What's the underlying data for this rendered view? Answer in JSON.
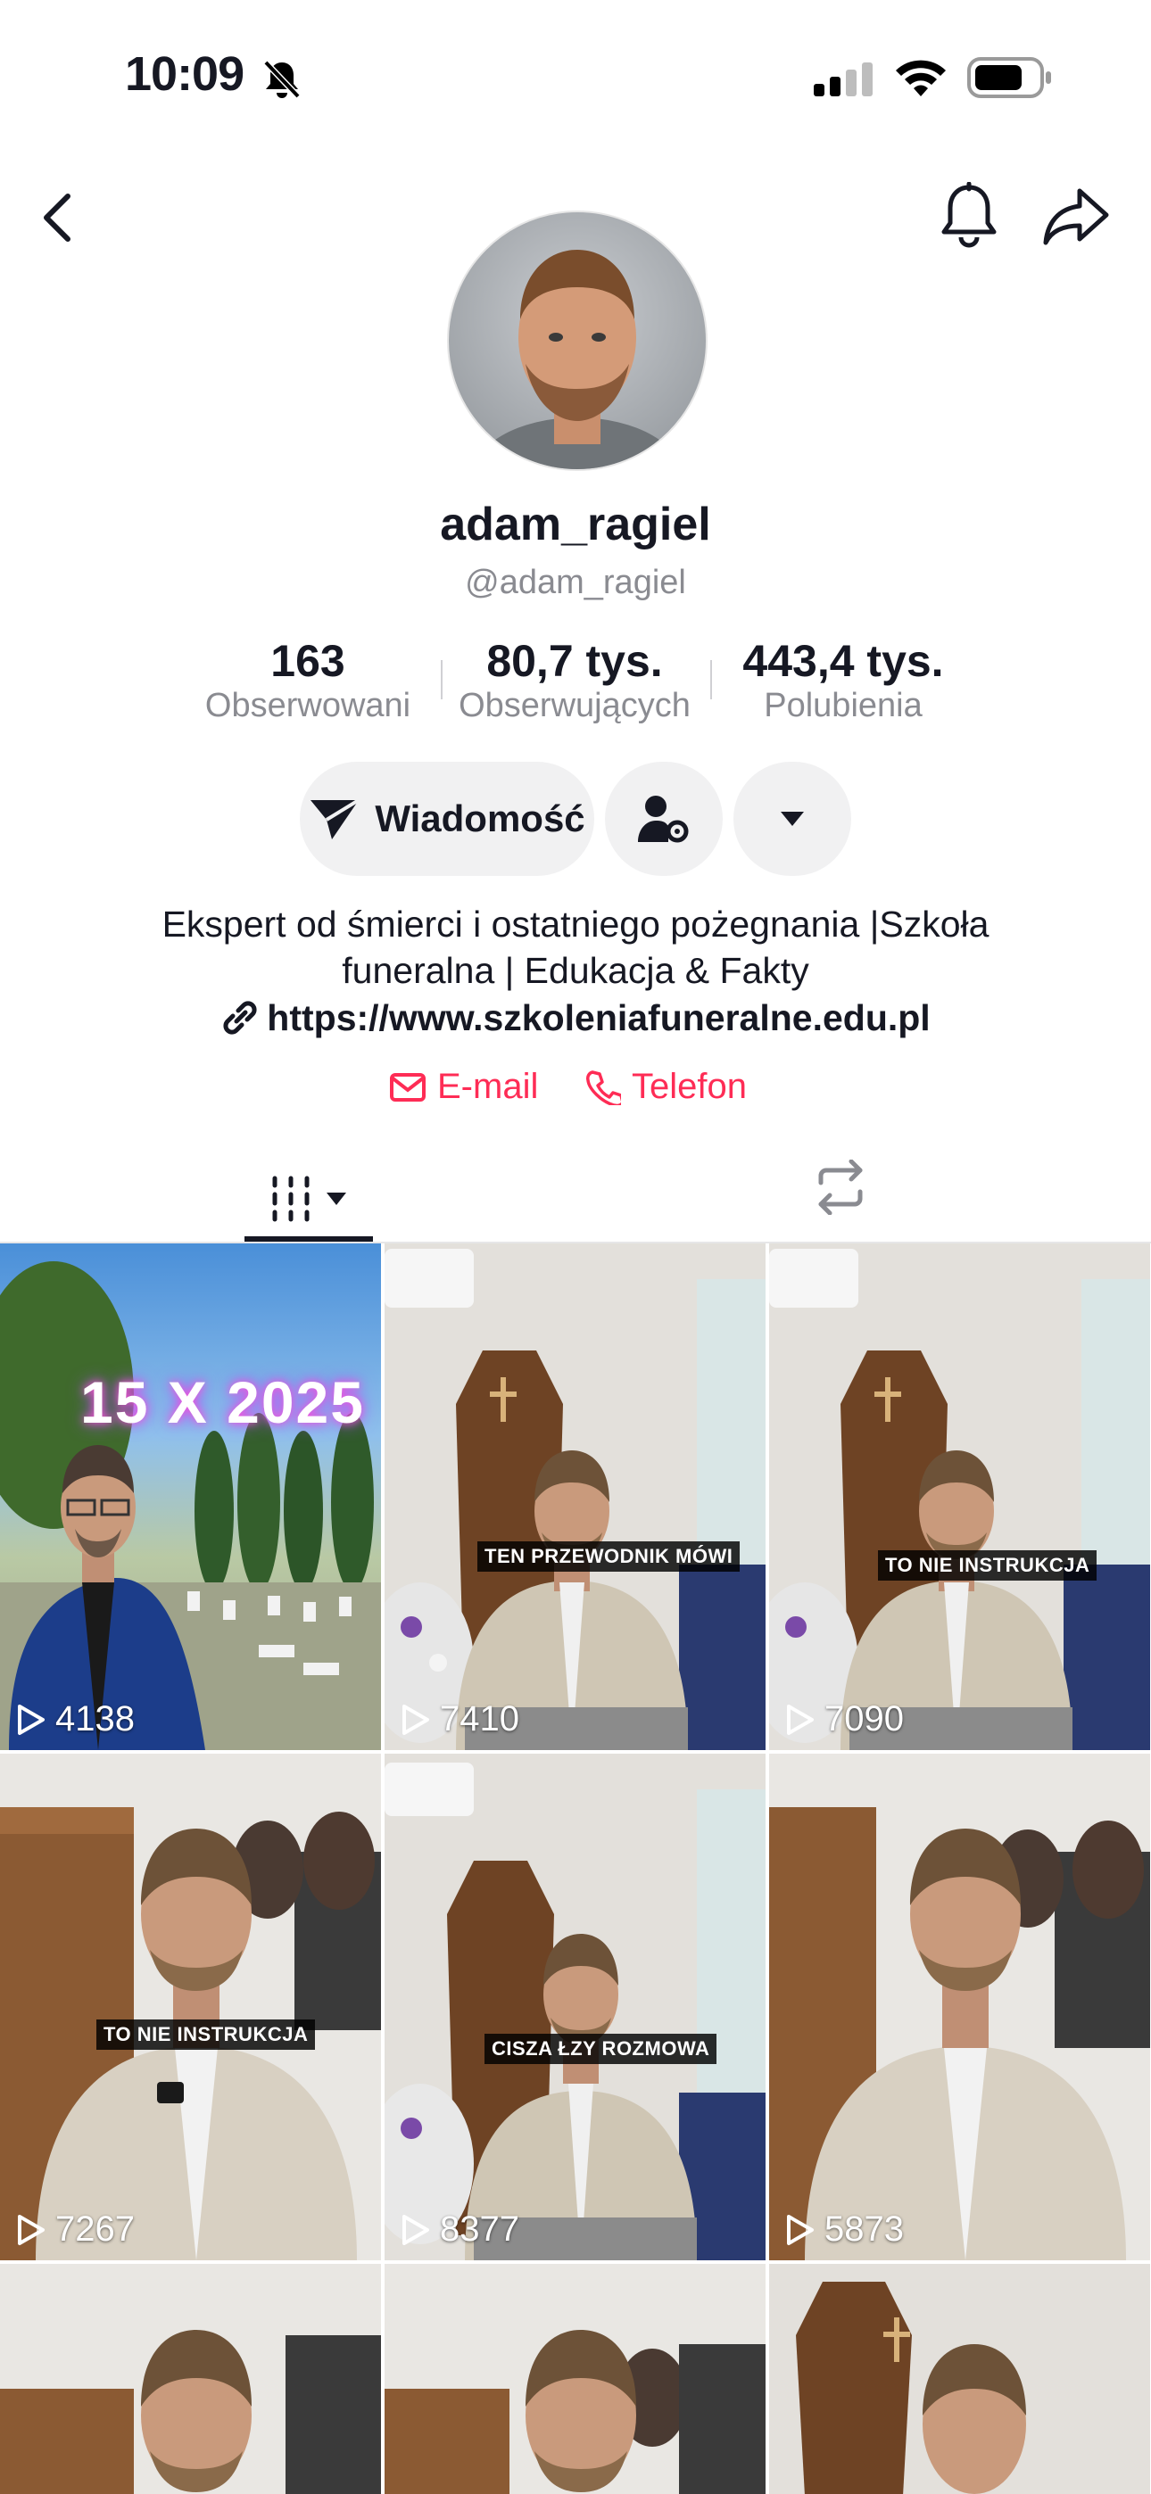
{
  "status_bar": {
    "time": "10:09"
  },
  "profile": {
    "username": "adam_ragiel",
    "handle": "@adam_ragiel",
    "stats": [
      {
        "value": "163",
        "label": "Obserwowani"
      },
      {
        "value": "80,7 tys.",
        "label": "Obserwujących"
      },
      {
        "value": "443,4 tys.",
        "label": "Polubienia"
      }
    ],
    "message_button": "Wiadomość",
    "bio_line1": "Ekspert od śmierci i ostatniego pożegnania |Szkoła",
    "bio_line2": "funeralna | Edukacja & Fakty",
    "link": "https://www.szkoleniafuneralne.edu.pl",
    "email_label": "E-mail",
    "phone_label": "Telefon"
  },
  "videos": [
    {
      "views": "4138",
      "overlay": "15 X 2025"
    },
    {
      "views": "7410",
      "caption": "TEN PRZEWODNIK MÓWI"
    },
    {
      "views": "7090",
      "caption": "TO NIE INSTRUKCJA"
    },
    {
      "views": "7267",
      "caption": "TO NIE INSTRUKCJA"
    },
    {
      "views": "8377",
      "caption": "CISZA ŁZY ROZMOWA"
    },
    {
      "views": "5873",
      "caption": ""
    }
  ],
  "colors": {
    "accent": "#fe2c55",
    "text": "#161823",
    "muted": "#8a8b91",
    "button_bg": "#f1f1f2"
  }
}
